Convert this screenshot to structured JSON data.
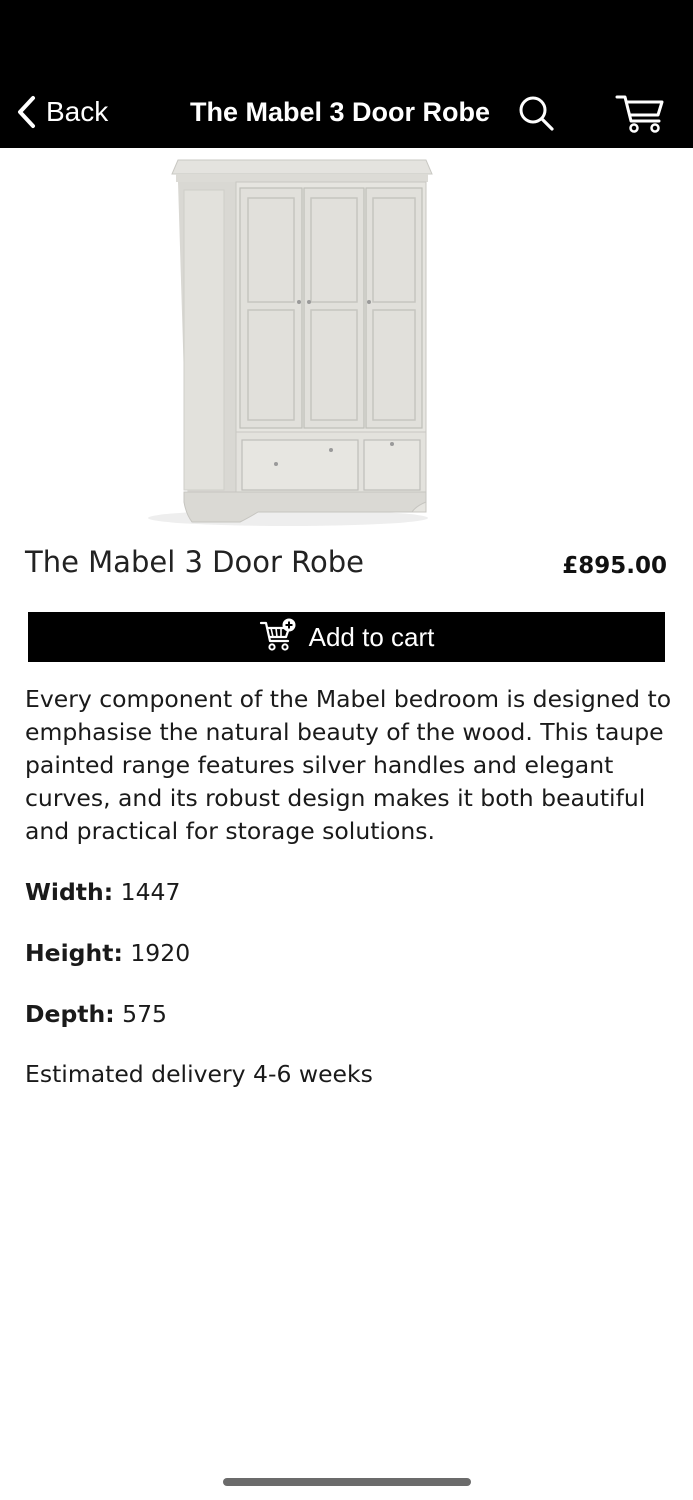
{
  "nav": {
    "back_label": "Back",
    "title": "The Mabel 3 Door Robe",
    "back_icon": "chevron-left-icon",
    "search_icon": "search-icon",
    "cart_icon": "cart-icon"
  },
  "product": {
    "name": "The Mabel 3 Door Robe",
    "price": "£895.00",
    "image_icon": "wardrobe-image",
    "add_to_cart_label": "Add to cart",
    "add_to_cart_icon": "cart-plus-icon",
    "description": "Every component of the Mabel bedroom is designed to emphasise the natural beauty of the wood. This taupe painted range features silver handles and elegant curves, and its robust design makes it both beautiful and practical for storage solutions.",
    "specs": {
      "width_label": "Width:",
      "width_value": "1447",
      "height_label": "Height:",
      "height_value": "1920",
      "depth_label": "Depth:",
      "depth_value": "575"
    },
    "delivery": "Estimated delivery 4-6 weeks"
  },
  "colors": {
    "bar_background": "#000000",
    "bar_foreground": "#ffffff",
    "button_background": "#000000",
    "page_background": "#ffffff"
  }
}
